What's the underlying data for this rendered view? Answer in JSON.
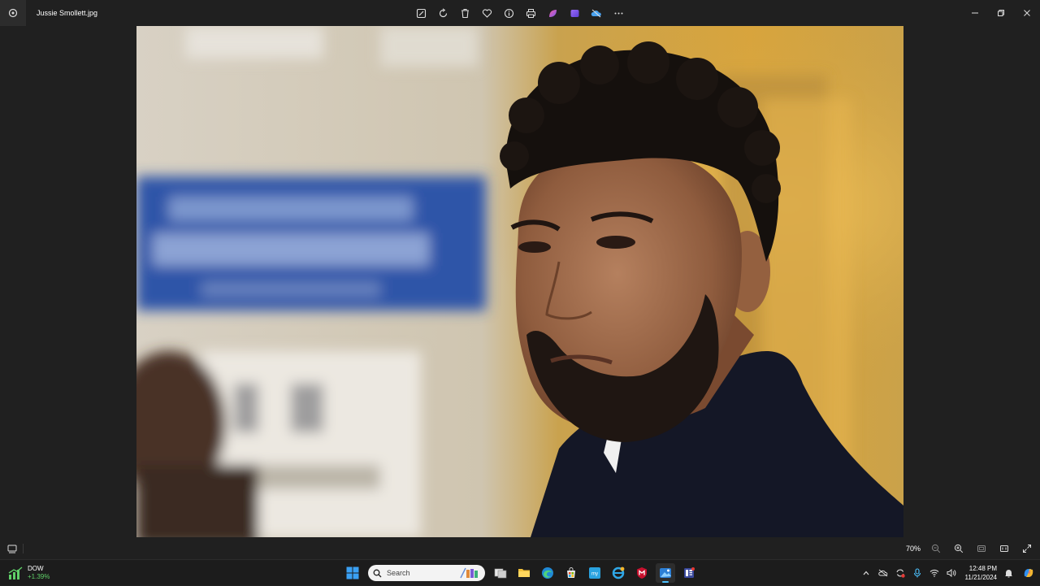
{
  "window": {
    "file_name": "Jussie Smollett.jpg"
  },
  "toolbar": {
    "icons": [
      "edit-icon",
      "rotate-icon",
      "delete-icon",
      "favorite-icon",
      "info-icon",
      "print-icon",
      "designer-icon",
      "clipchamp-icon",
      "onedrive-icon",
      "more-icon"
    ]
  },
  "viewer": {
    "zoom_label": "70%"
  },
  "taskbar": {
    "widget": {
      "name": "DOW",
      "value": "+1.39%"
    },
    "search_placeholder": "Search",
    "clock": {
      "time": "12:48 PM",
      "date": "11/21/2024"
    }
  },
  "colors": {
    "accent": "#4cc2ff",
    "window_bg": "#202020",
    "taskbar_bg": "#1c1c1c",
    "stock_up": "#5fd068"
  }
}
